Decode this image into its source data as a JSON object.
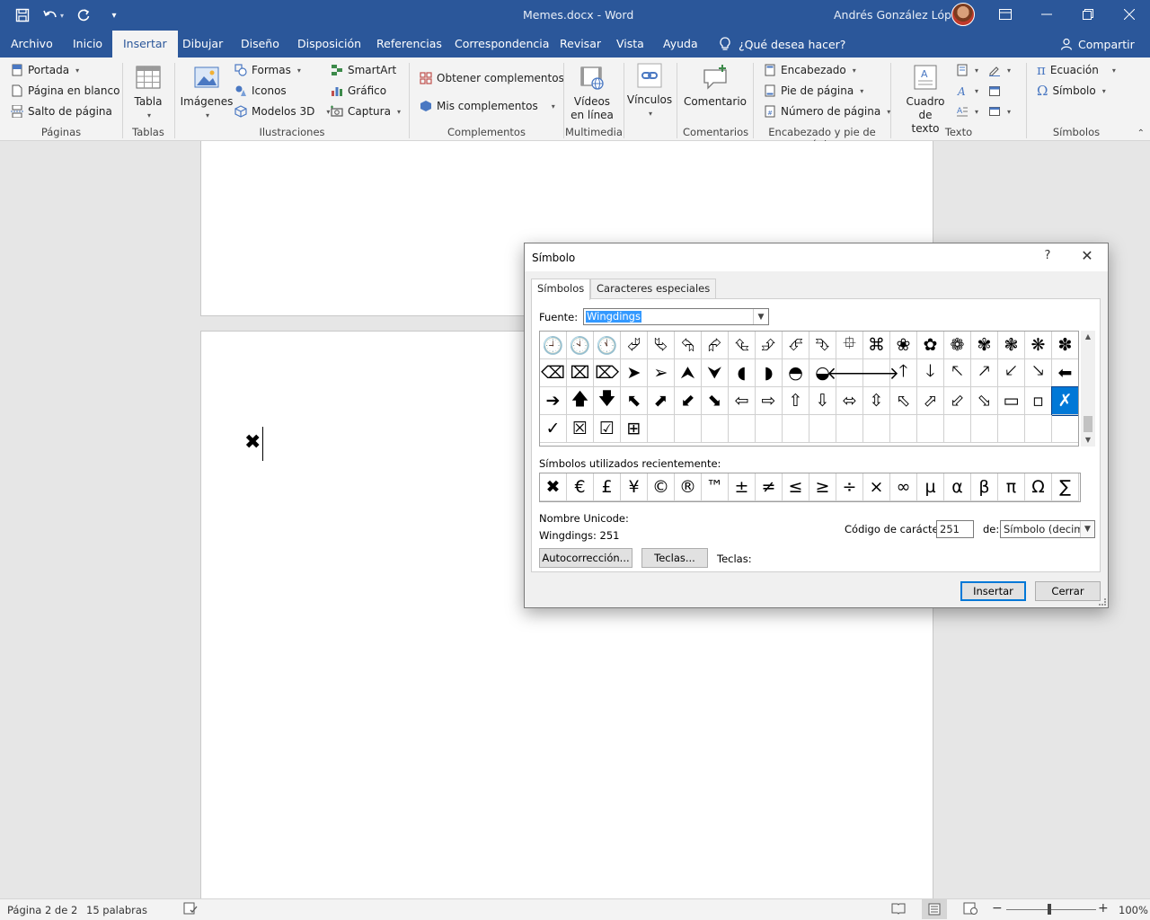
{
  "titlebar": {
    "doc_title": "Memes.docx  -  Word",
    "user_name": "Andrés González López",
    "qat_icons": [
      "save-icon",
      "undo-icon",
      "redo-icon",
      "customize-qat-icon"
    ],
    "controls": [
      "ribbon-display-icon",
      "minimize-icon",
      "restore-icon",
      "close-icon"
    ]
  },
  "tabs": [
    "Archivo",
    "Inicio",
    "Insertar",
    "Dibujar",
    "Diseño",
    "Disposición",
    "Referencias",
    "Correspondencia",
    "Revisar",
    "Vista",
    "Ayuda"
  ],
  "active_tab": "Insertar",
  "tellme": "¿Qué desea hacer?",
  "share": "Compartir",
  "ribbon": {
    "paginas": {
      "label": "Páginas",
      "items": [
        "Portada",
        "Página en blanco",
        "Salto de página"
      ]
    },
    "tablas": {
      "label": "Tablas",
      "tabla": "Tabla"
    },
    "ilustraciones": {
      "label": "Ilustraciones",
      "imagenes": "Imágenes",
      "formas": "Formas",
      "iconos": "Iconos",
      "modelos": "Modelos 3D",
      "smartart": "SmartArt",
      "grafico": "Gráfico",
      "captura": "Captura"
    },
    "complementos": {
      "label": "Complementos",
      "obtener": "Obtener complementos",
      "mis": "Mis complementos"
    },
    "multimedia": {
      "label": "Multimedia",
      "videos_1": "Vídeos",
      "videos_2": "en línea"
    },
    "vinculos": {
      "label": "",
      "vinculos": "Vínculos"
    },
    "comentarios": {
      "label": "Comentarios",
      "comentario": "Comentario"
    },
    "encabezado": {
      "label": "Encabezado y pie de página",
      "encabezado": "Encabezado",
      "pie": "Pie de página",
      "numero": "Número de página"
    },
    "texto": {
      "label": "Texto",
      "cuadro_1": "Cuadro de",
      "cuadro_2": "texto"
    },
    "simbolos": {
      "label": "Símbolos",
      "ecuacion": "Ecuación",
      "simbolo": "Símbolo"
    }
  },
  "document": {
    "typed_symbol": "✖"
  },
  "statusbar": {
    "page": "Página 2 de 2",
    "words": "15 palabras",
    "zoom": "100%"
  },
  "dialog": {
    "title": "Símbolo",
    "help": "?",
    "tabs": [
      "Símbolos",
      "Caracteres especiales"
    ],
    "font_label": "Fuente:",
    "font_value": "Wingdings",
    "symbols": [
      "🕘",
      "🕙",
      "🕚",
      "⮰",
      "⮱",
      "⮲",
      "⮳",
      "⮴",
      "⮵",
      "⮶",
      "⮷",
      "⯐",
      "⌘",
      "❀",
      "✿",
      "❁",
      "✾",
      "❃",
      "❋",
      "✽",
      "⌫",
      "⌧",
      "⌦",
      "➤",
      "➢",
      "⮝",
      "⮟",
      "◖",
      "◗",
      "◓",
      "◒",
      "🡐",
      "🡒",
      "🡑",
      "🡓",
      "🡔",
      "🡕",
      "🡗",
      "🡖",
      "⬅",
      "➔",
      "🡅",
      "🡇",
      "⬉",
      "⬈",
      "⬋",
      "⬊",
      "⇦",
      "⇨",
      "⇧",
      "⇩",
      "⬄",
      "⇳",
      "⬁",
      "⬀",
      "⬃",
      "⬂",
      "▭",
      "▫",
      "✗",
      "✓",
      "☒",
      "☑",
      "⊞",
      "",
      "",
      "",
      "",
      "",
      "",
      "",
      "",
      "",
      "",
      "",
      "",
      "",
      "",
      "",
      ""
    ],
    "selected_index": 59,
    "recent_label": "Símbolos utilizados recientemente:",
    "recent": [
      "✖",
      "€",
      "£",
      "¥",
      "©",
      "®",
      "™",
      "±",
      "≠",
      "≤",
      "≥",
      "÷",
      "×",
      "∞",
      "µ",
      "α",
      "β",
      "π",
      "Ω",
      "∑"
    ],
    "unicode_name_label": "Nombre Unicode:",
    "unicode_name_value": "Wingdings: 251",
    "char_code_label": "Código de carácter:",
    "char_code_value": "251",
    "from_label": "de:",
    "from_value": "Símbolo (decimal)",
    "autocorrect": "Autocorrección...",
    "shortcut_btn": "Teclas...",
    "shortcut_label": "Teclas:",
    "insert": "Insertar",
    "close": "Cerrar"
  }
}
